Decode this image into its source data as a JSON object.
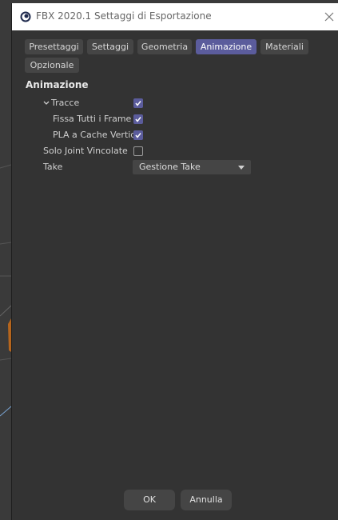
{
  "window": {
    "title": "FBX 2020.1 Settaggi di Esportazione",
    "icon": "cinema4d-icon",
    "close_icon": "close-icon"
  },
  "tabs": [
    {
      "label": "Presettaggi",
      "active": false
    },
    {
      "label": "Settaggi",
      "active": false
    },
    {
      "label": "Geometria",
      "active": false
    },
    {
      "label": "Animazione",
      "active": true
    },
    {
      "label": "Materiali",
      "active": false
    },
    {
      "label": "Opzionale",
      "active": false
    }
  ],
  "section": {
    "title": "Animazione"
  },
  "options": {
    "tracce": {
      "label": "Tracce",
      "checked": true,
      "expanded": true
    },
    "fissa_frame": {
      "label": "Fissa Tutti i Frame",
      "checked": true
    },
    "pla_cache": {
      "label": "PLA a Cache Vertice",
      "checked": true
    },
    "solo_joint": {
      "label": "Solo Joint Vincolate",
      "checked": false
    },
    "take": {
      "label": "Take",
      "value": "Gestione Take"
    }
  },
  "buttons": {
    "ok": "OK",
    "cancel": "Annulla"
  },
  "colors": {
    "accent": "#5b5c9c",
    "panel": "#333333",
    "control": "#454545"
  }
}
